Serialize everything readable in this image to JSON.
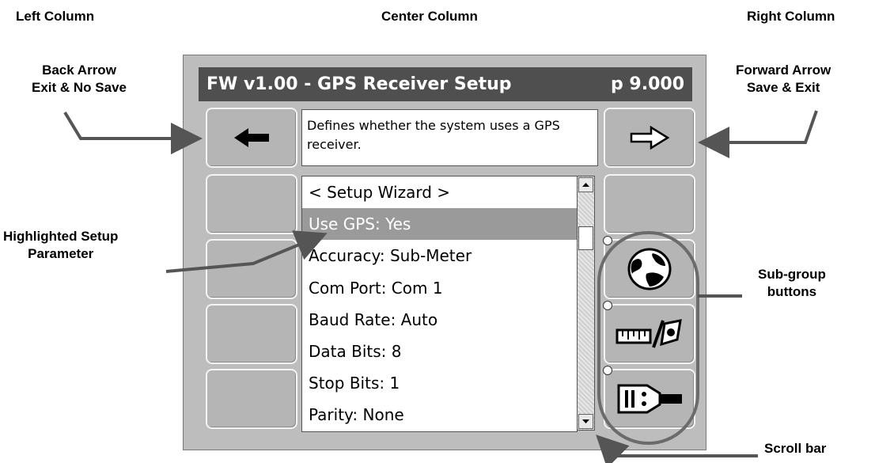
{
  "annotations": {
    "left_column": "Left Column",
    "center_column": "Center Column",
    "right_column": "Right Column",
    "back_arrow": [
      "Back Arrow",
      "Exit & No Save"
    ],
    "forward_arrow": [
      "Forward Arrow",
      "Save & Exit"
    ],
    "highlighted": [
      "Highlighted Setup",
      "Parameter"
    ],
    "subgroup": [
      "Sub-group",
      "buttons"
    ],
    "scroll_bar": "Scroll bar"
  },
  "screen": {
    "title": "FW v1.00 - GPS Receiver Setup",
    "page": "p 9.000",
    "help_text": "Defines whether the system uses a GPS receiver.",
    "list": [
      "< Setup Wizard >",
      "Use GPS: Yes",
      "Accuracy: Sub-Meter",
      "Com Port: Com 1",
      "Baud Rate: Auto",
      "Data Bits: 8",
      "Stop Bits: 1",
      "Parity: None"
    ],
    "selected_index": 1,
    "icons": {
      "back": "left-arrow-icon",
      "forward": "right-arrow-icon",
      "subgroup1": "globe-icon",
      "subgroup2": "ruler-satellite-icon",
      "subgroup3": "serial-connector-icon"
    }
  }
}
